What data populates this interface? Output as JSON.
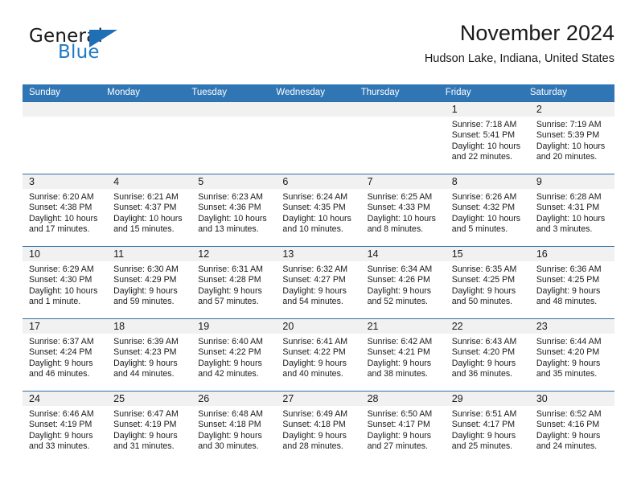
{
  "brand": {
    "name_top": "General",
    "name_bottom": "Blue",
    "colors": {
      "dark": "#1a1a1a",
      "blue": "#1f7ac4",
      "triangle": "#1f6fb7"
    }
  },
  "header": {
    "title": "November 2024",
    "subtitle": "Hudson Lake, Indiana, United States"
  },
  "theme": {
    "header_blue": "#3075b4",
    "row_border": "#2f6fa8",
    "daynum_band": "#f1f1f1",
    "page_background": "#ffffff"
  },
  "weekday_headers": [
    "Sunday",
    "Monday",
    "Tuesday",
    "Wednesday",
    "Thursday",
    "Friday",
    "Saturday"
  ],
  "weeks": [
    [
      {
        "day": "",
        "sunrise": "",
        "sunset": "",
        "daylight": ""
      },
      {
        "day": "",
        "sunrise": "",
        "sunset": "",
        "daylight": ""
      },
      {
        "day": "",
        "sunrise": "",
        "sunset": "",
        "daylight": ""
      },
      {
        "day": "",
        "sunrise": "",
        "sunset": "",
        "daylight": ""
      },
      {
        "day": "",
        "sunrise": "",
        "sunset": "",
        "daylight": ""
      },
      {
        "day": "1",
        "sunrise": "Sunrise: 7:18 AM",
        "sunset": "Sunset: 5:41 PM",
        "daylight": "Daylight: 10 hours and 22 minutes."
      },
      {
        "day": "2",
        "sunrise": "Sunrise: 7:19 AM",
        "sunset": "Sunset: 5:39 PM",
        "daylight": "Daylight: 10 hours and 20 minutes."
      }
    ],
    [
      {
        "day": "3",
        "sunrise": "Sunrise: 6:20 AM",
        "sunset": "Sunset: 4:38 PM",
        "daylight": "Daylight: 10 hours and 17 minutes."
      },
      {
        "day": "4",
        "sunrise": "Sunrise: 6:21 AM",
        "sunset": "Sunset: 4:37 PM",
        "daylight": "Daylight: 10 hours and 15 minutes."
      },
      {
        "day": "5",
        "sunrise": "Sunrise: 6:23 AM",
        "sunset": "Sunset: 4:36 PM",
        "daylight": "Daylight: 10 hours and 13 minutes."
      },
      {
        "day": "6",
        "sunrise": "Sunrise: 6:24 AM",
        "sunset": "Sunset: 4:35 PM",
        "daylight": "Daylight: 10 hours and 10 minutes."
      },
      {
        "day": "7",
        "sunrise": "Sunrise: 6:25 AM",
        "sunset": "Sunset: 4:33 PM",
        "daylight": "Daylight: 10 hours and 8 minutes."
      },
      {
        "day": "8",
        "sunrise": "Sunrise: 6:26 AM",
        "sunset": "Sunset: 4:32 PM",
        "daylight": "Daylight: 10 hours and 5 minutes."
      },
      {
        "day": "9",
        "sunrise": "Sunrise: 6:28 AM",
        "sunset": "Sunset: 4:31 PM",
        "daylight": "Daylight: 10 hours and 3 minutes."
      }
    ],
    [
      {
        "day": "10",
        "sunrise": "Sunrise: 6:29 AM",
        "sunset": "Sunset: 4:30 PM",
        "daylight": "Daylight: 10 hours and 1 minute."
      },
      {
        "day": "11",
        "sunrise": "Sunrise: 6:30 AM",
        "sunset": "Sunset: 4:29 PM",
        "daylight": "Daylight: 9 hours and 59 minutes."
      },
      {
        "day": "12",
        "sunrise": "Sunrise: 6:31 AM",
        "sunset": "Sunset: 4:28 PM",
        "daylight": "Daylight: 9 hours and 57 minutes."
      },
      {
        "day": "13",
        "sunrise": "Sunrise: 6:32 AM",
        "sunset": "Sunset: 4:27 PM",
        "daylight": "Daylight: 9 hours and 54 minutes."
      },
      {
        "day": "14",
        "sunrise": "Sunrise: 6:34 AM",
        "sunset": "Sunset: 4:26 PM",
        "daylight": "Daylight: 9 hours and 52 minutes."
      },
      {
        "day": "15",
        "sunrise": "Sunrise: 6:35 AM",
        "sunset": "Sunset: 4:25 PM",
        "daylight": "Daylight: 9 hours and 50 minutes."
      },
      {
        "day": "16",
        "sunrise": "Sunrise: 6:36 AM",
        "sunset": "Sunset: 4:25 PM",
        "daylight": "Daylight: 9 hours and 48 minutes."
      }
    ],
    [
      {
        "day": "17",
        "sunrise": "Sunrise: 6:37 AM",
        "sunset": "Sunset: 4:24 PM",
        "daylight": "Daylight: 9 hours and 46 minutes."
      },
      {
        "day": "18",
        "sunrise": "Sunrise: 6:39 AM",
        "sunset": "Sunset: 4:23 PM",
        "daylight": "Daylight: 9 hours and 44 minutes."
      },
      {
        "day": "19",
        "sunrise": "Sunrise: 6:40 AM",
        "sunset": "Sunset: 4:22 PM",
        "daylight": "Daylight: 9 hours and 42 minutes."
      },
      {
        "day": "20",
        "sunrise": "Sunrise: 6:41 AM",
        "sunset": "Sunset: 4:22 PM",
        "daylight": "Daylight: 9 hours and 40 minutes."
      },
      {
        "day": "21",
        "sunrise": "Sunrise: 6:42 AM",
        "sunset": "Sunset: 4:21 PM",
        "daylight": "Daylight: 9 hours and 38 minutes."
      },
      {
        "day": "22",
        "sunrise": "Sunrise: 6:43 AM",
        "sunset": "Sunset: 4:20 PM",
        "daylight": "Daylight: 9 hours and 36 minutes."
      },
      {
        "day": "23",
        "sunrise": "Sunrise: 6:44 AM",
        "sunset": "Sunset: 4:20 PM",
        "daylight": "Daylight: 9 hours and 35 minutes."
      }
    ],
    [
      {
        "day": "24",
        "sunrise": "Sunrise: 6:46 AM",
        "sunset": "Sunset: 4:19 PM",
        "daylight": "Daylight: 9 hours and 33 minutes."
      },
      {
        "day": "25",
        "sunrise": "Sunrise: 6:47 AM",
        "sunset": "Sunset: 4:19 PM",
        "daylight": "Daylight: 9 hours and 31 minutes."
      },
      {
        "day": "26",
        "sunrise": "Sunrise: 6:48 AM",
        "sunset": "Sunset: 4:18 PM",
        "daylight": "Daylight: 9 hours and 30 minutes."
      },
      {
        "day": "27",
        "sunrise": "Sunrise: 6:49 AM",
        "sunset": "Sunset: 4:18 PM",
        "daylight": "Daylight: 9 hours and 28 minutes."
      },
      {
        "day": "28",
        "sunrise": "Sunrise: 6:50 AM",
        "sunset": "Sunset: 4:17 PM",
        "daylight": "Daylight: 9 hours and 27 minutes."
      },
      {
        "day": "29",
        "sunrise": "Sunrise: 6:51 AM",
        "sunset": "Sunset: 4:17 PM",
        "daylight": "Daylight: 9 hours and 25 minutes."
      },
      {
        "day": "30",
        "sunrise": "Sunrise: 6:52 AM",
        "sunset": "Sunset: 4:16 PM",
        "daylight": "Daylight: 9 hours and 24 minutes."
      }
    ]
  ]
}
